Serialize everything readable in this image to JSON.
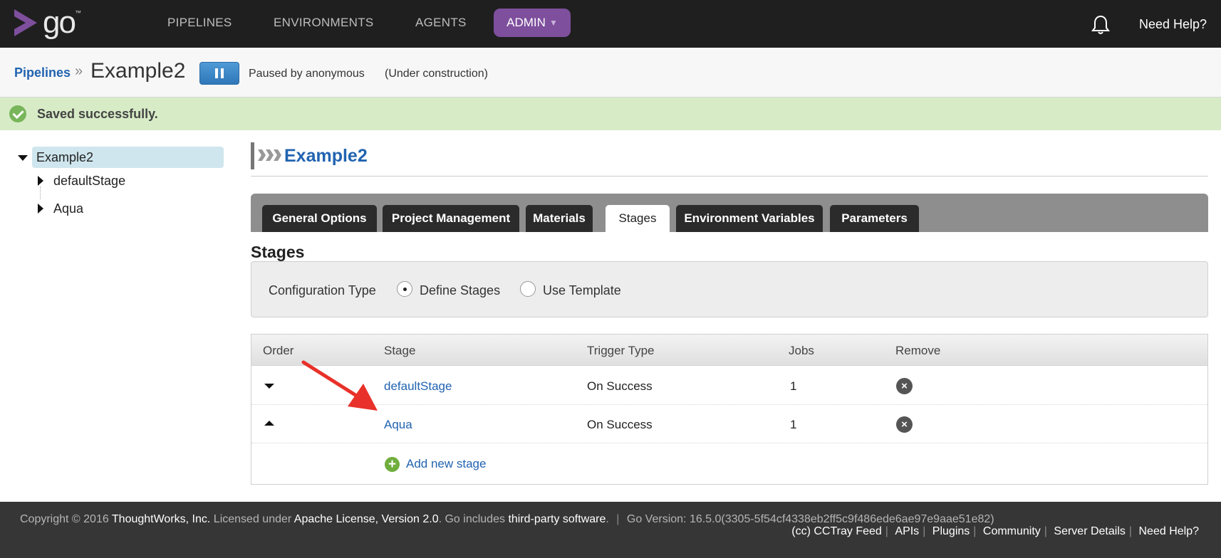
{
  "brand": {
    "logo_text": "go",
    "trademark": "™"
  },
  "nav": {
    "items": [
      "PIPELINES",
      "ENVIRONMENTS",
      "AGENTS"
    ],
    "admin_label": "ADMIN",
    "need_help": "Need Help?"
  },
  "page_header": {
    "breadcrumb": "Pipelines",
    "separator": "»",
    "pipeline_name": "Example2",
    "paused_by": "Paused by anonymous",
    "status": "(Under construction)"
  },
  "flash": {
    "message": "Saved successfully.",
    "color": "#d7ecc6"
  },
  "tree": {
    "root": "Example2",
    "children": [
      "defaultStage",
      "Aqua"
    ]
  },
  "main": {
    "title": "Example2",
    "tabs": [
      "General Options",
      "Project Management",
      "Materials",
      "Stages",
      "Environment Variables",
      "Parameters"
    ],
    "active_tab": "Stages",
    "section_title": "Stages",
    "config": {
      "label": "Configuration Type",
      "options": [
        "Define Stages",
        "Use Template"
      ],
      "selected": "Define Stages"
    },
    "table": {
      "headers": [
        "Order",
        "Stage",
        "Trigger Type",
        "Jobs",
        "Remove"
      ],
      "rows": [
        {
          "stage": "defaultStage",
          "trigger": "On Success",
          "jobs": "1",
          "order_icon": "move-down-icon"
        },
        {
          "stage": "Aqua",
          "trigger": "On Success",
          "jobs": "1",
          "order_icon": "move-up-icon"
        }
      ],
      "add_label": "Add new stage"
    }
  },
  "footer": {
    "copyright_prefix": "Copyright © 2016",
    "company": "ThoughtWorks, Inc.",
    "licensed": "Licensed under",
    "license": "Apache License, Version 2.0",
    "go_includes": ". Go includes",
    "third_party": "third-party software",
    "period": ".",
    "version": "Go Version: 16.5.0(3305-5f54cf4338eb2ff5c9f486ede6ae97e9aae51e82)",
    "links": [
      "(cc) CCTray Feed",
      "APIs",
      "Plugins",
      "Community",
      "Server Details",
      "Need Help?"
    ]
  },
  "colors": {
    "brand_purple": "#7e4f9d",
    "link_blue": "#2163b0",
    "arrow_red": "#e8312a"
  }
}
